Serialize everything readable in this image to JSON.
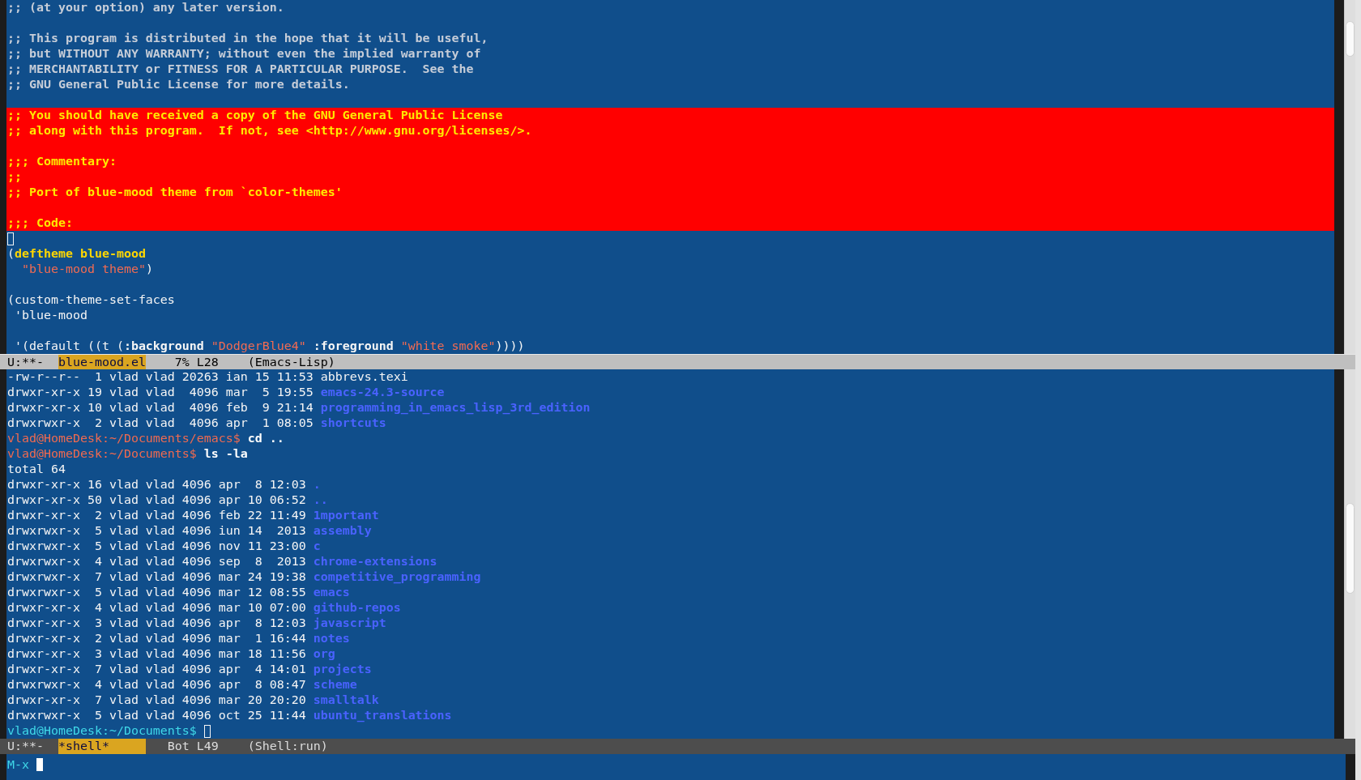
{
  "editor_window": {
    "selected": false,
    "lines": [
      {
        "highlighted": false,
        "segments": [
          {
            "kind": "comment",
            "text": ";; (at your option) any later version."
          }
        ]
      },
      {
        "highlighted": false
      },
      {
        "highlighted": false,
        "segments": [
          {
            "kind": "comment",
            "text": ";; This program is distributed in the hope that it will be useful,"
          }
        ]
      },
      {
        "highlighted": false,
        "segments": [
          {
            "kind": "comment",
            "text": ";; but WITHOUT ANY WARRANTY; without even the implied warranty of"
          }
        ]
      },
      {
        "highlighted": false,
        "segments": [
          {
            "kind": "comment",
            "text": ";; MERCHANTABILITY or FITNESS FOR A PARTICULAR PURPOSE.  See the"
          }
        ]
      },
      {
        "highlighted": false,
        "segments": [
          {
            "kind": "comment",
            "text": ";; GNU General Public License for more details."
          }
        ]
      },
      {
        "highlighted": false
      },
      {
        "highlighted": true,
        "segments": [
          {
            "kind": "comment",
            "text": ";; You should have received a copy of the GNU General Public License"
          }
        ]
      },
      {
        "highlighted": true,
        "segments": [
          {
            "kind": "comment",
            "text": ";; along with this program.  If not, see <http://www.gnu.org/licenses/>."
          }
        ]
      },
      {
        "highlighted": true
      },
      {
        "highlighted": true,
        "segments": [
          {
            "kind": "comment",
            "text": ";;; Commentary:"
          }
        ]
      },
      {
        "highlighted": true,
        "segments": [
          {
            "kind": "comment",
            "text": ";;"
          }
        ]
      },
      {
        "highlighted": true,
        "segments": [
          {
            "kind": "comment",
            "text": ";; Port of blue-mood theme from `color-themes'"
          }
        ]
      },
      {
        "highlighted": true
      },
      {
        "highlighted": true,
        "segments": [
          {
            "kind": "comment",
            "text": ";;; Code:"
          }
        ]
      },
      {
        "highlighted": false,
        "cursor": true
      },
      {
        "highlighted": false,
        "segments": [
          {
            "kind": "plain",
            "text": "("
          },
          {
            "kind": "keyword",
            "text": "deftheme blue-mood"
          }
        ]
      },
      {
        "highlighted": false,
        "segments": [
          {
            "kind": "string",
            "text": "  \"blue-mood theme\""
          },
          {
            "kind": "plain",
            "text": ")"
          }
        ]
      },
      {
        "highlighted": false
      },
      {
        "highlighted": false,
        "segments": [
          {
            "kind": "plain",
            "text": "(custom-theme-set-faces"
          }
        ]
      },
      {
        "highlighted": false,
        "segments": [
          {
            "kind": "plain",
            "text": " 'blue-mood"
          }
        ]
      },
      {
        "highlighted": false
      },
      {
        "highlighted": false,
        "segments": [
          {
            "kind": "plain",
            "text": " '(default ((t ("
          },
          {
            "kind": "builtin",
            "text": ":background"
          },
          {
            "kind": "string",
            "text": " \"DodgerBlue4\""
          },
          {
            "kind": "builtin",
            "text": " :foreground"
          },
          {
            "kind": "string",
            "text": " \"white smoke\""
          },
          {
            "kind": "plain",
            "text": "))))"
          }
        ]
      }
    ],
    "mode_line": {
      "active": true,
      "status": "U:**-",
      "buffer": "blue-mood.el",
      "position": "7% L28",
      "mode": "(Emacs-Lisp)"
    }
  },
  "shell_window": {
    "selected": false,
    "lines": [
      {
        "segments": [
          {
            "kind": "listing",
            "text": "-rw-r--r--  1 vlad vlad 20263 ian 15 11:53 abbrevs.texi"
          }
        ]
      },
      {
        "segments": [
          {
            "kind": "listing",
            "text": "drwxr-xr-x 19 vlad vlad  4096 mar  5 19:55 "
          },
          {
            "kind": "directory",
            "text": "emacs-24.3-source"
          }
        ]
      },
      {
        "segments": [
          {
            "kind": "listing",
            "text": "drwxr-xr-x 10 vlad vlad  4096 feb  9 21:14 "
          },
          {
            "kind": "directory",
            "text": "programming_in_emacs_lisp_3rd_edition"
          }
        ]
      },
      {
        "segments": [
          {
            "kind": "listing",
            "text": "drwxrwxr-x  2 vlad vlad  4096 apr  1 08:05 "
          },
          {
            "kind": "directory",
            "text": "shortcuts"
          }
        ]
      },
      {
        "segments": [
          {
            "kind": "prompt",
            "text": "vlad@HomeDesk:~/Documents/emacs$"
          },
          {
            "kind": "command",
            "text": " cd .."
          }
        ]
      },
      {
        "segments": [
          {
            "kind": "prompt",
            "text": "vlad@HomeDesk:~/Documents$"
          },
          {
            "kind": "command",
            "text": " ls -la"
          }
        ]
      },
      {
        "segments": [
          {
            "kind": "listing",
            "text": "total 64"
          }
        ]
      },
      {
        "segments": [
          {
            "kind": "listing",
            "text": "drwxr-xr-x 16 vlad vlad 4096 apr  8 12:03 "
          },
          {
            "kind": "directory",
            "text": "."
          }
        ]
      },
      {
        "segments": [
          {
            "kind": "listing",
            "text": "drwxr-xr-x 50 vlad vlad 4096 apr 10 06:52 "
          },
          {
            "kind": "directory",
            "text": ".."
          }
        ]
      },
      {
        "segments": [
          {
            "kind": "listing",
            "text": "drwxr-xr-x  2 vlad vlad 4096 feb 22 11:49 "
          },
          {
            "kind": "directory",
            "text": "1mportant"
          }
        ]
      },
      {
        "segments": [
          {
            "kind": "listing",
            "text": "drwxrwxr-x  5 vlad vlad 4096 iun 14  2013 "
          },
          {
            "kind": "directory",
            "text": "assembly"
          }
        ]
      },
      {
        "segments": [
          {
            "kind": "listing",
            "text": "drwxrwxr-x  5 vlad vlad 4096 nov 11 23:00 "
          },
          {
            "kind": "directory",
            "text": "c"
          }
        ]
      },
      {
        "segments": [
          {
            "kind": "listing",
            "text": "drwxrwxr-x  4 vlad vlad 4096 sep  8  2013 "
          },
          {
            "kind": "directory",
            "text": "chrome-extensions"
          }
        ]
      },
      {
        "segments": [
          {
            "kind": "listing",
            "text": "drwxrwxr-x  7 vlad vlad 4096 mar 24 19:38 "
          },
          {
            "kind": "directory",
            "text": "competitive_programming"
          }
        ]
      },
      {
        "segments": [
          {
            "kind": "listing",
            "text": "drwxrwxr-x  5 vlad vlad 4096 mar 12 08:55 "
          },
          {
            "kind": "directory",
            "text": "emacs"
          }
        ]
      },
      {
        "segments": [
          {
            "kind": "listing",
            "text": "drwxr-xr-x  4 vlad vlad 4096 mar 10 07:00 "
          },
          {
            "kind": "directory",
            "text": "github-repos"
          }
        ]
      },
      {
        "segments": [
          {
            "kind": "listing",
            "text": "drwxr-xr-x  3 vlad vlad 4096 apr  8 12:03 "
          },
          {
            "kind": "directory",
            "text": "javascript"
          }
        ]
      },
      {
        "segments": [
          {
            "kind": "listing",
            "text": "drwxr-xr-x  2 vlad vlad 4096 mar  1 16:44 "
          },
          {
            "kind": "directory",
            "text": "notes"
          }
        ]
      },
      {
        "segments": [
          {
            "kind": "listing",
            "text": "drwxr-xr-x  3 vlad vlad 4096 mar 18 11:56 "
          },
          {
            "kind": "directory",
            "text": "org"
          }
        ]
      },
      {
        "segments": [
          {
            "kind": "listing",
            "text": "drwxr-xr-x  7 vlad vlad 4096 apr  4 14:01 "
          },
          {
            "kind": "directory",
            "text": "projects"
          }
        ]
      },
      {
        "segments": [
          {
            "kind": "listing",
            "text": "drwxrwxr-x  4 vlad vlad 4096 apr  8 08:47 "
          },
          {
            "kind": "directory",
            "text": "scheme"
          }
        ]
      },
      {
        "segments": [
          {
            "kind": "listing",
            "text": "drwxr-xr-x  7 vlad vlad 4096 mar 20 20:20 "
          },
          {
            "kind": "directory",
            "text": "smalltalk"
          }
        ]
      },
      {
        "segments": [
          {
            "kind": "listing",
            "text": "drwxrwxr-x  5 vlad vlad 4096 oct 25 11:44 "
          },
          {
            "kind": "directory",
            "text": "ubuntu_translations"
          }
        ]
      },
      {
        "segments": [
          {
            "kind": "input_prompt",
            "text": "vlad@HomeDesk:~/Documents$"
          }
        ],
        "cursor": true
      }
    ],
    "mode_line": {
      "active": false,
      "status": "U:**-",
      "buffer": "*shell*",
      "position": "Bot L49",
      "mode": "(Shell:run)"
    }
  },
  "minibuffer": {
    "selected": true,
    "prompt": "M-x",
    "cursor": true
  }
}
